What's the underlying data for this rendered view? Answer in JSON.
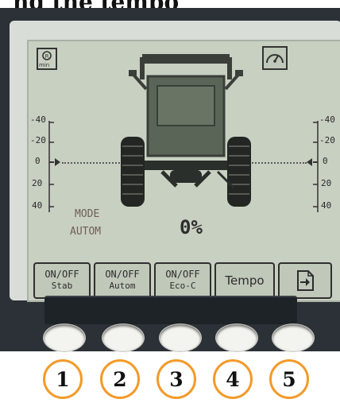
{
  "caption": {
    "text": "ng the tempo"
  },
  "screen": {
    "mode_label": "MODE",
    "mode_value": "AUTOM",
    "percent": "0%",
    "icons": {
      "left": "engine-rpm-icon",
      "right": "speedometer-icon"
    },
    "icon_left_text": "min",
    "scale_left": [
      "-40",
      "-20",
      "0",
      "20",
      "40"
    ],
    "scale_right": [
      "-40",
      "-20",
      "0",
      "20",
      "40"
    ]
  },
  "softkeys": [
    {
      "line1": "ON/OFF",
      "line2": "Stab"
    },
    {
      "line1": "ON/OFF",
      "line2": "Autom"
    },
    {
      "line1": "ON/OFF",
      "line2": "Eco-C"
    },
    {
      "line1": "Tempo",
      "line2": ""
    },
    {
      "line1": "",
      "line2": "",
      "icon": "page-arrow-icon"
    }
  ],
  "buttons": {
    "numbers": [
      "1",
      "2",
      "3",
      "4",
      "5"
    ]
  },
  "colors": {
    "lcd": "#c8d0c2",
    "accent": "#f39a2a",
    "device": "#2b3136"
  }
}
